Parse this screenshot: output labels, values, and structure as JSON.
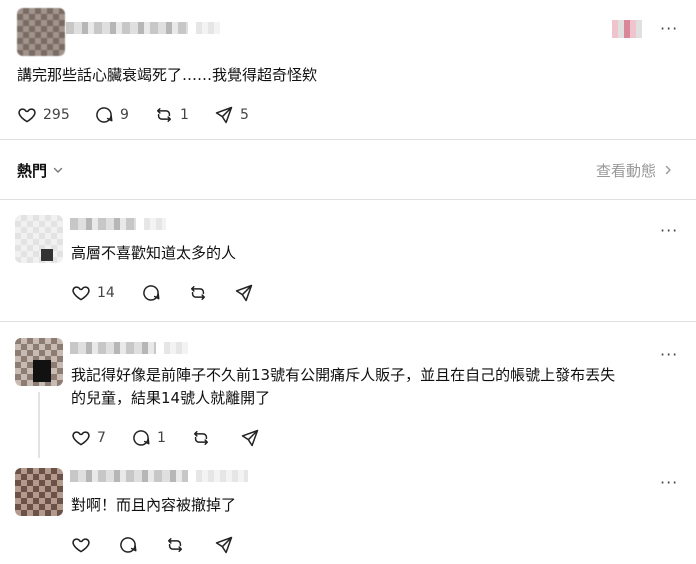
{
  "post": {
    "text": "講完那些話心臟衰竭死了……我覺得超奇怪欸",
    "likes": "295",
    "replies": "9",
    "reposts": "1",
    "shares": "5",
    "more": "···"
  },
  "filter": {
    "label": "熱門",
    "view_activity": "查看動態"
  },
  "comments": [
    {
      "text": "高層不喜歡知道太多的人",
      "likes": "14",
      "replies": "",
      "more": "···"
    },
    {
      "text_line1": "我記得好像是前陣子不久前13號有公開痛斥人販子，並且在自己的帳號上發布丟失",
      "text_line2": "的兒童，結果14號人就離開了",
      "likes": "7",
      "replies": "1",
      "more": "···"
    },
    {
      "text": "對啊！而且內容被撤掉了",
      "likes": "",
      "replies": "",
      "more": "···"
    }
  ],
  "icons": [
    "heart-icon",
    "comment-icon",
    "repost-icon",
    "share-icon",
    "chevron-down-icon",
    "chevron-right-icon",
    "more-icon"
  ]
}
